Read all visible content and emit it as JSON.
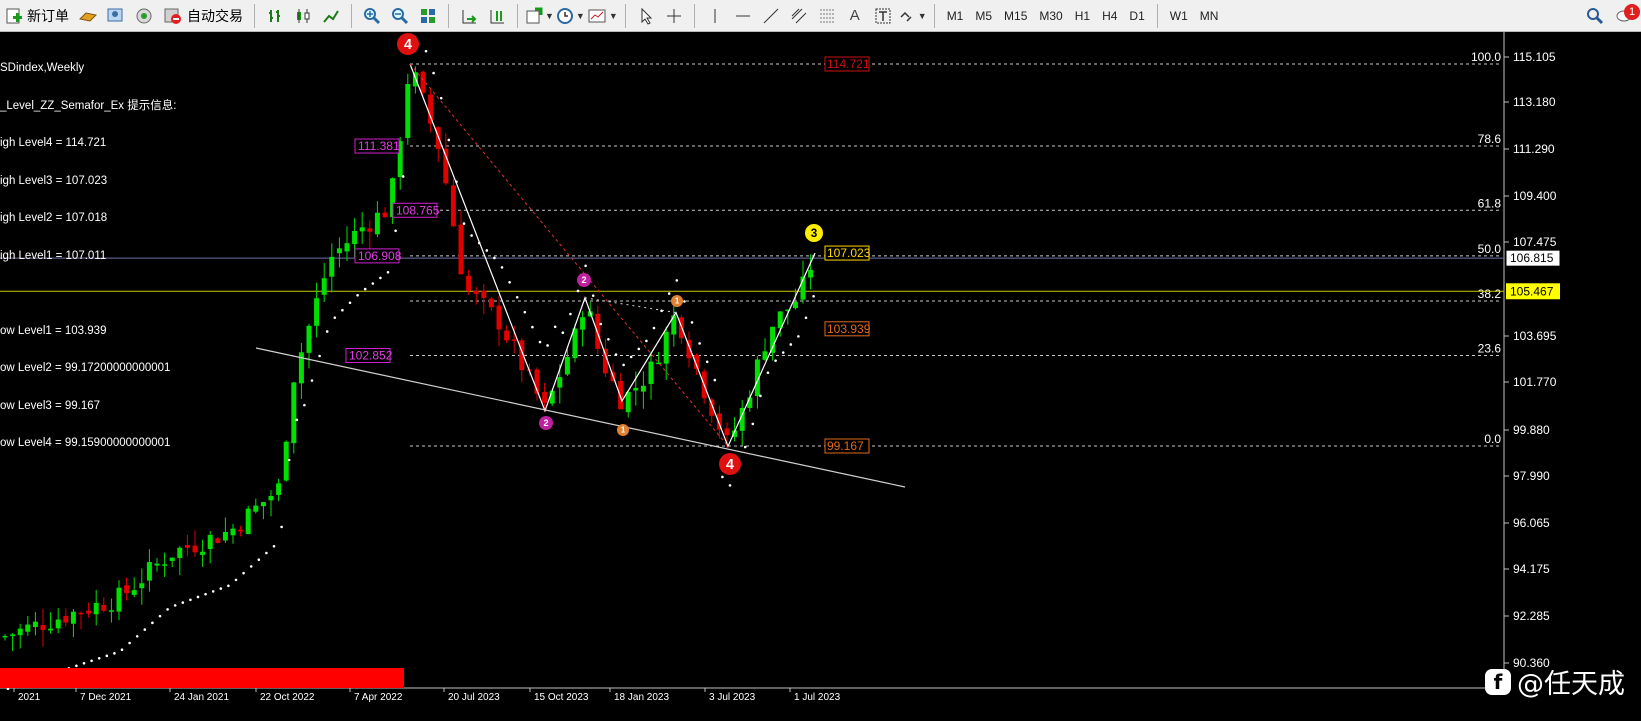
{
  "toolbar": {
    "new_order_label": "新订单",
    "auto_trade_label": "自动交易",
    "timeframes": [
      "M1",
      "M5",
      "M15",
      "M30",
      "H1",
      "H4",
      "D1",
      "W1",
      "MN"
    ],
    "notification_count": "1"
  },
  "chart": {
    "symbol_title": "SDindex,Weekly",
    "indicator_lines": [
      "_Level_ZZ_Semafor_Ex 提示信息:",
      "igh Level4 = 114.721",
      "igh Level3 = 107.023",
      "igh Level2 = 107.018",
      "igh Level1 = 107.011",
      "",
      "ow Level1 = 103.939",
      "ow Level2 = 99.17200000000001",
      "ow Level3 = 99.167",
      "ow Level4 = 99.15900000000001"
    ],
    "price_scale": [
      "115.105",
      "113.180",
      "111.290",
      "109.400",
      "107.475",
      "103.695",
      "101.770",
      "99.880",
      "97.990",
      "96.065",
      "94.175",
      "92.285",
      "90.360"
    ],
    "price_tags": {
      "current": "105.467",
      "line": "106.815"
    },
    "fib_levels": [
      {
        "label": "100.0",
        "price": 114.721
      },
      {
        "label": "78.6",
        "price": 111.381
      },
      {
        "label": "61.8",
        "price": 108.765
      },
      {
        "label": "50.0",
        "price": 106.908
      },
      {
        "label": "38.2",
        "price": 105.07
      },
      {
        "label": "23.6",
        "price": 102.852
      },
      {
        "label": "0.0",
        "price": 99.167
      }
    ],
    "fib_boxes": [
      "111.381",
      "108.765",
      "106.908",
      "102.852"
    ],
    "level_boxes": [
      {
        "text": "114.721",
        "color": "#c81010"
      },
      {
        "text": "107.023",
        "color": "#ffd700"
      },
      {
        "text": "103.939",
        "color": "#e06a1a"
      },
      {
        "text": "99.167",
        "color": "#e06a1a"
      }
    ],
    "semafor_markers": [
      "4",
      "2",
      "1",
      "4",
      "3",
      "2",
      "1"
    ],
    "x_labels": [
      "2021",
      "7 Dec 2021",
      "24 Jan 2021",
      "22 Oct 2022",
      "7 Apr 2022",
      "20 Jul 2023",
      "15 Oct 2023",
      "18 Jan 2023",
      "3 Jul 2023",
      "1 Jul 2023"
    ],
    "colors": {
      "bull": "#00e000",
      "bear": "#e00000",
      "grid": "#c0c0c0",
      "price_line": "#c8c800"
    }
  },
  "watermark": {
    "icon": "facebook-icon",
    "text": "@任天成"
  }
}
